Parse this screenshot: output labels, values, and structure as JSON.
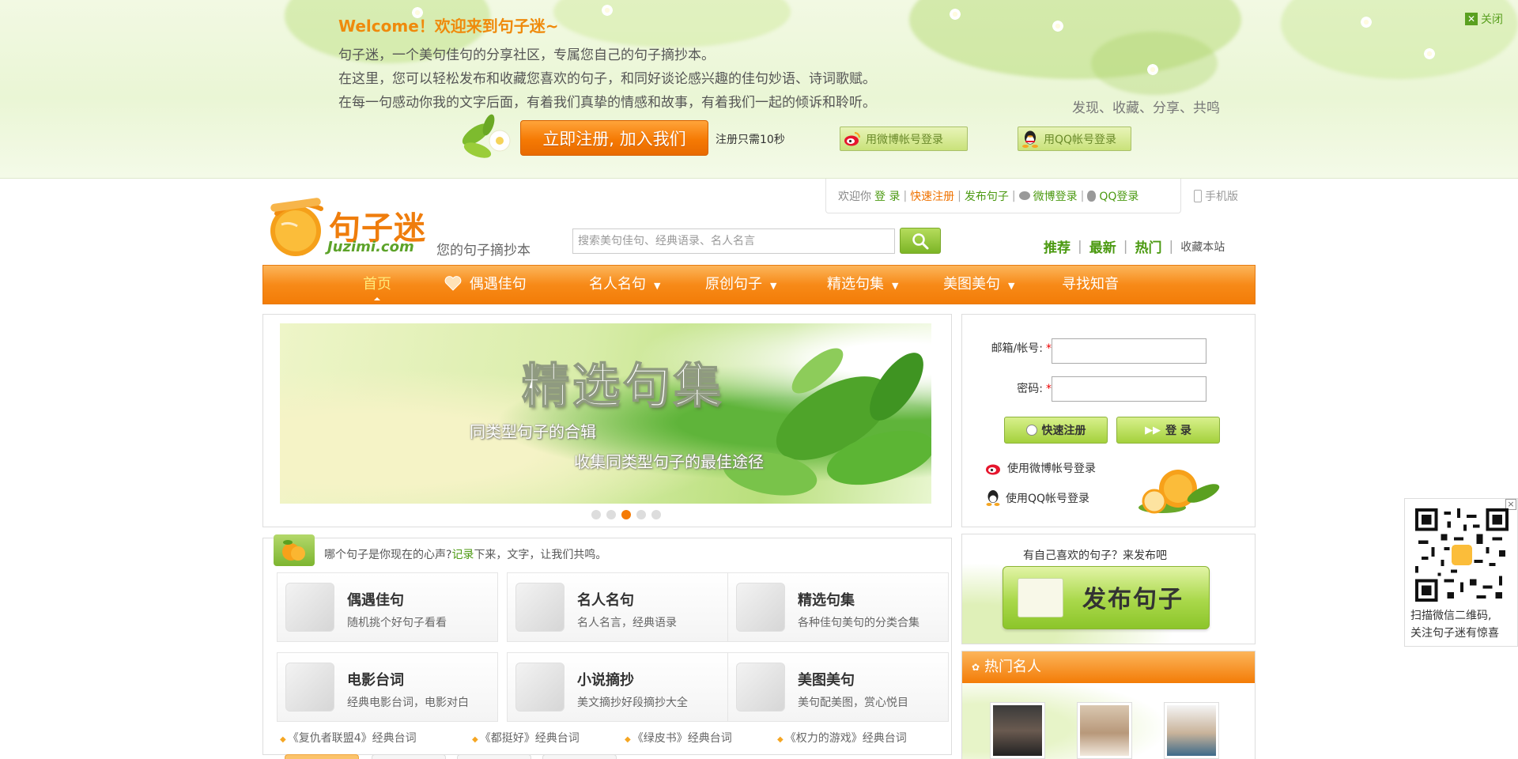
{
  "banner": {
    "welcome": "Welcome！欢迎来到句子迷~",
    "lines": [
      "句子迷，一个美句佳句的分享社区，专属您自己的句子摘抄本。",
      "在这里，您可以轻松发布和收藏您喜欢的句子，和同好谈论感兴趣的佳句妙语、诗词歌赋。",
      "在每一句感动你我的文字后面，有着我们真挚的情感和故事，有着我们一起的倾诉和聆听。"
    ],
    "slogan": "发现、收藏、分享、共鸣",
    "close_label": "关闭",
    "register_label": "立即注册, 加入我们",
    "register_note": "注册只需10秒",
    "weibo_login": "用微博帐号登录",
    "qq_login": "用QQ帐号登录"
  },
  "topbar": {
    "greeting": "欢迎你",
    "login": "登 录",
    "quick_register": "快速注册",
    "publish": "发布句子",
    "weibo": "微博登录",
    "qq": "QQ登录",
    "mobile": "手机版"
  },
  "logo": {
    "cn": "句子迷",
    "en": "Juzimi.com",
    "tagline": "您的句子摘抄本"
  },
  "search": {
    "placeholder": "搜索美句佳句、经典语录、名人名言"
  },
  "quick_nav": {
    "recommend": "推荐",
    "latest": "最新",
    "hot": "热门",
    "favorite": "收藏本站"
  },
  "nav": {
    "items": [
      {
        "label": "首页",
        "dropdown": false
      },
      {
        "label": "偶遇佳句",
        "dropdown": false
      },
      {
        "label": "名人名句",
        "dropdown": true
      },
      {
        "label": "原创句子",
        "dropdown": true
      },
      {
        "label": "精选句集",
        "dropdown": true
      },
      {
        "label": "美图美句",
        "dropdown": true
      },
      {
        "label": "寻找知音",
        "dropdown": false
      }
    ],
    "active_index": 0
  },
  "slider": {
    "title": "精选句集",
    "sub1": "同类型句子的合辑",
    "sub2": "收集同类型句子的最佳途径",
    "dots": 5,
    "active_dot": 2
  },
  "categories": {
    "prompt_before": "哪个句子是你现在的心声?",
    "prompt_link": "记录",
    "prompt_after": "下来，文字，让我们共鸣。",
    "cards": [
      {
        "title": "偶遇佳句",
        "desc": "随机挑个好句子看看",
        "icon": "teacup-icon"
      },
      {
        "title": "名人名句",
        "desc": "名人名言，经典语录",
        "icon": "bust-icon"
      },
      {
        "title": "精选句集",
        "desc": "各种佳句美句的分类合集",
        "icon": "folder-icon"
      },
      {
        "title": "电影台词",
        "desc": "经典电影台词，电影对白",
        "icon": "film-reel-icon"
      },
      {
        "title": "小说摘抄",
        "desc": "美文摘抄好段摘抄大全",
        "icon": "book-icon"
      },
      {
        "title": "美图美句",
        "desc": "美句配美图，赏心悦目",
        "icon": "photo-icon"
      }
    ],
    "movie_links": [
      "《复仇者联盟4》经典台词",
      "《都挺好》经典台词",
      "《绿皮书》经典台词",
      "《权力的游戏》经典台词"
    ]
  },
  "login": {
    "account_label": "邮箱/帐号:",
    "password_label": "密码:",
    "required_mark": "*",
    "quick_register": "快速注册",
    "login": "登 录",
    "weibo": "使用微博帐号登录",
    "qq": "使用QQ帐号登录"
  },
  "publish": {
    "prompt": "有自己喜欢的句子？来发布吧",
    "button": "发布句子"
  },
  "hot_people": {
    "title": "热门名人",
    "names": [
      "",
      "",
      ""
    ]
  },
  "qr": {
    "line1": "扫描微信二维码,",
    "line2": "关注句子迷有惊喜",
    "close": "×"
  },
  "colors": {
    "orange": "#f57a04",
    "green": "#4c9a12",
    "banner_bg": "#eaf6d5"
  }
}
